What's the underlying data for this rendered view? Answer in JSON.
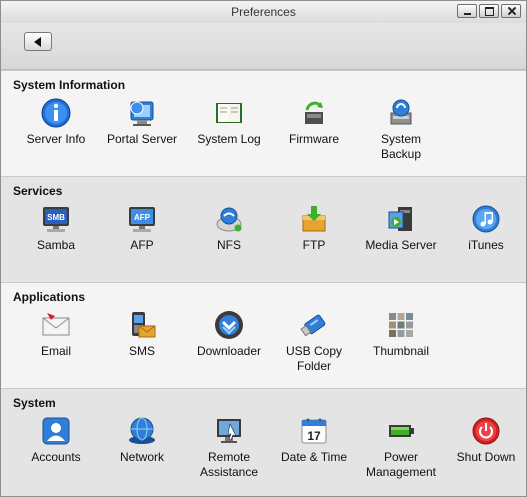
{
  "window": {
    "title": "Preferences"
  },
  "toolbar": {
    "back_icon": "back-arrow-icon"
  },
  "colors": {
    "accent_blue": "#1f6fd6",
    "power_red": "#d62020",
    "ftp_orange": "#e8a431"
  },
  "sections": [
    {
      "title": "System Information",
      "items": [
        {
          "label1": "Server Info",
          "label2": "",
          "icon": "info-icon"
        },
        {
          "label1": "Portal Server",
          "label2": "",
          "icon": "portal-server-icon"
        },
        {
          "label1": "System Log",
          "label2": "",
          "icon": "system-log-icon"
        },
        {
          "label1": "Firmware",
          "label2": "",
          "icon": "firmware-icon"
        },
        {
          "label1": "System",
          "label2": "Backup",
          "icon": "system-backup-icon"
        }
      ]
    },
    {
      "title": "Services",
      "items": [
        {
          "label1": "Samba",
          "label2": "",
          "icon": "samba-icon",
          "badge": "SMB"
        },
        {
          "label1": "AFP",
          "label2": "",
          "icon": "afp-icon",
          "badge": "AFP"
        },
        {
          "label1": "NFS",
          "label2": "",
          "icon": "nfs-icon"
        },
        {
          "label1": "FTP",
          "label2": "",
          "icon": "ftp-icon"
        },
        {
          "label1": "Media Server",
          "label2": "",
          "icon": "media-server-icon"
        },
        {
          "label1": "iTunes",
          "label2": "",
          "icon": "itunes-icon"
        }
      ]
    },
    {
      "title": "Applications",
      "items": [
        {
          "label1": "Email",
          "label2": "",
          "icon": "email-icon"
        },
        {
          "label1": "SMS",
          "label2": "",
          "icon": "sms-icon"
        },
        {
          "label1": "Downloader",
          "label2": "",
          "icon": "downloader-icon"
        },
        {
          "label1": "USB Copy",
          "label2": "Folder",
          "icon": "usb-copy-icon"
        },
        {
          "label1": "Thumbnail",
          "label2": "",
          "icon": "thumbnail-icon"
        }
      ]
    },
    {
      "title": "System",
      "items": [
        {
          "label1": "Accounts",
          "label2": "",
          "icon": "accounts-icon"
        },
        {
          "label1": "Network",
          "label2": "",
          "icon": "network-icon"
        },
        {
          "label1": "Remote",
          "label2": "Assistance",
          "icon": "remote-assistance-icon"
        },
        {
          "label1": "Date & Time",
          "label2": "",
          "icon": "calendar-icon",
          "badge": "17"
        },
        {
          "label1": "Power",
          "label2": "Management",
          "icon": "power-management-icon"
        },
        {
          "label1": "Shut Down",
          "label2": "",
          "icon": "shutdown-icon"
        }
      ]
    }
  ]
}
